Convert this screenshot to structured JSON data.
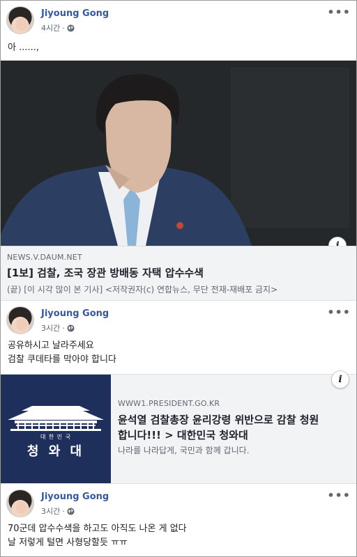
{
  "posts": [
    {
      "author": "Jiyoung Gong",
      "time": "4시간",
      "separator": "·",
      "text_lines": [
        "아 ......,"
      ],
      "link": {
        "domain": "NEWS.V.DAUM.NET",
        "title": "[1보] 검찰, 조국 장관 방배동 자택 압수수색",
        "description": "(끝) [이 시각 많이 본 기사] <저작권자(c) 연합뉴스, 무단 전재-재배포 금지>"
      }
    },
    {
      "author": "Jiyoung Gong",
      "time": "3시간",
      "separator": "·",
      "text_lines": [
        "공유하시고 날라주세요",
        "검찰 쿠데타를 막아야 합니다"
      ],
      "link": {
        "image_text_small": "대 한 민 국",
        "image_text_large": "청 와 대",
        "domain": "WWW1.PRESIDENT.GO.KR",
        "title_lines": [
          "윤석열 검찰총장 윤리강령 위반으로 감찰 청원",
          "합니다!!! > 대한민국 청와대"
        ],
        "description": "나라를 나라답게, 국민과 함께 갑니다."
      }
    },
    {
      "author": "Jiyoung Gong",
      "time": "3시간",
      "separator": "·",
      "text_lines": [
        "70군데 압수수색을 하고도 아직도 나온 게 없다",
        "날 저렇게 털면 사형당할듯 ㅠㅠ"
      ]
    }
  ],
  "more_glyph": "•••",
  "info_glyph": "i",
  "icons": {
    "audience": "globe-icon",
    "more": "more-options-icon",
    "info": "info-icon"
  },
  "colors": {
    "name": "#385898",
    "meta": "#606770",
    "link_bg": "#f2f3f5",
    "bluehouse_bg": "#1f2f5c"
  }
}
